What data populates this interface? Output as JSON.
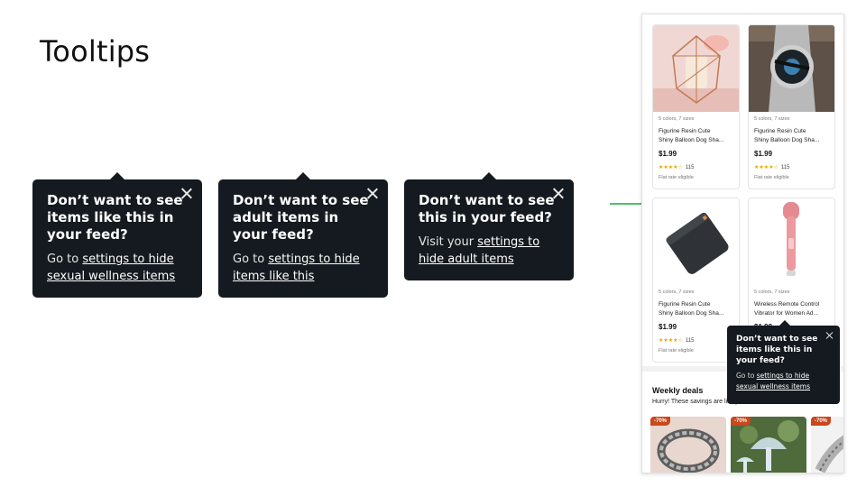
{
  "slide": {
    "title": "Tooltips"
  },
  "tooltips": [
    {
      "heading": "Don’t want to see items like this in your feed?",
      "body_prefix": "Go to ",
      "link": "settings to hide sexual wellness items"
    },
    {
      "heading": "Don’t want to see adult items in your feed?",
      "body_prefix": "Go to ",
      "link": "settings to hide items like this"
    },
    {
      "heading": "Don’t want to see this in your feed?",
      "body_prefix": "Visit your ",
      "link": "settings to hide adult items"
    }
  ],
  "phone": {
    "products": [
      {
        "meta": "5 colors, 7 sizes",
        "name_line1": "Figurine Resin Cute",
        "name_line2": "Shiny Balloon Dog Sha...",
        "price": "$1.99",
        "stars": "★★★★☆",
        "reviews": "115",
        "shipping": "Flat rate eligible",
        "icon": "candle-holder-image"
      },
      {
        "meta": "5 colors, 7 sizes",
        "name_line1": "Figurine Resin Cute",
        "name_line2": "Shiny Balloon Dog Sha...",
        "price": "$1.99",
        "stars": "★★★★☆",
        "reviews": "115",
        "shipping": "Flat rate eligible",
        "icon": "smartwatch-image"
      },
      {
        "meta": "5 colors, 7 sizes",
        "name_line1": "Figurine Resin Cute",
        "name_line2": "Shiny Balloon Dog Sha...",
        "price": "$1.99",
        "stars": "★★★★☆",
        "reviews": "115",
        "shipping": "Flat rate eligible",
        "icon": "power-bank-image"
      },
      {
        "meta": "5 colors, 7 sizes",
        "name_line1": "Wireless Remote Control",
        "name_line2": "Vibrator for Women Ad...",
        "price": "$1.99",
        "stars": "",
        "reviews": "",
        "shipping": "",
        "icon": "wand-massager-image"
      }
    ],
    "deals": {
      "title": "Weekly deals",
      "subtitle": "Hurry! These savings are likely to",
      "items": [
        {
          "badge": "-70%",
          "icon": "chain-bracelet-image"
        },
        {
          "badge": "-70%",
          "icon": "glass-mushroom-image"
        },
        {
          "badge": "-70%",
          "icon": "watch-band-image"
        }
      ]
    },
    "mini_tooltip": {
      "heading": "Don’t want to see items like this in your feed?",
      "body_prefix": "Go to ",
      "link": "settings to hide sexual wellness items"
    }
  },
  "colors": {
    "tooltip_bg": "#141a1f",
    "connector": "#4cc06a",
    "deal_badge": "#c9481c",
    "star": "#e8a500"
  }
}
